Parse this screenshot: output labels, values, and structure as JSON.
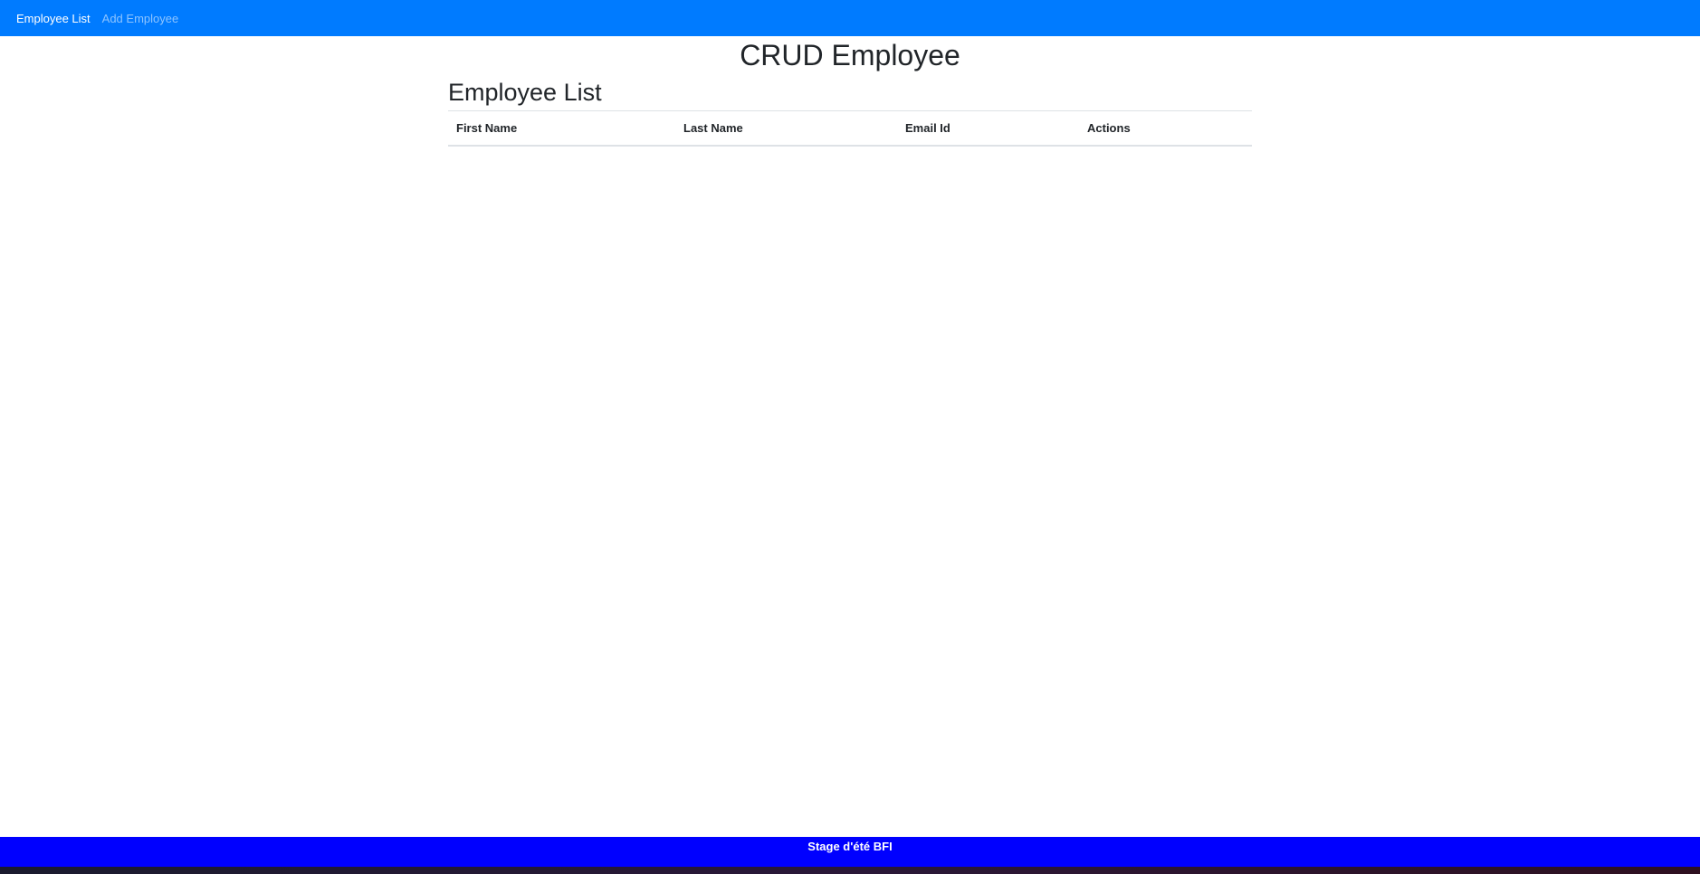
{
  "nav": {
    "items": [
      {
        "label": "Employee List",
        "active": true
      },
      {
        "label": "Add Employee",
        "active": false
      }
    ],
    "background": "#007bff"
  },
  "header": {
    "title": "CRUD Employee"
  },
  "main": {
    "section_title": "Employee List",
    "table": {
      "columns": [
        "First Name",
        "Last Name",
        "Email Id",
        "Actions"
      ],
      "rows": []
    }
  },
  "footer": {
    "text": "Stage d'été BFI",
    "background": "#0000ff"
  }
}
